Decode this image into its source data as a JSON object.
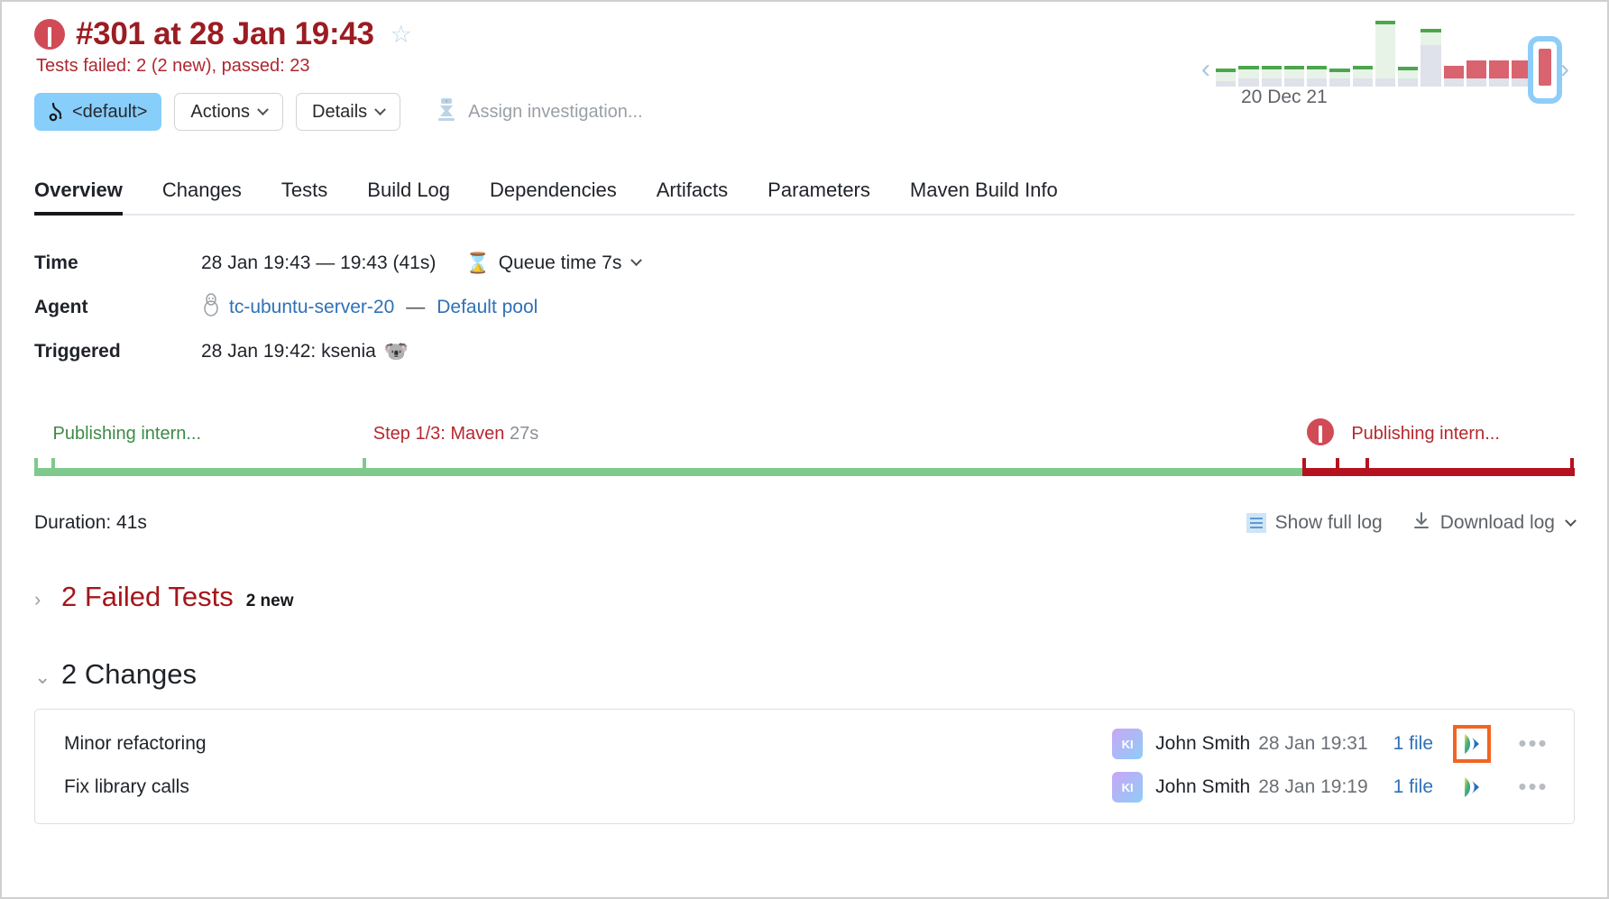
{
  "header": {
    "status_icon": "error-circle-icon",
    "title": "#301 at 28 Jan 19:43",
    "star_glyph": "☆",
    "status_text": "Tests failed: 2 (2 new), passed: 23"
  },
  "toolbar": {
    "branch_label": "<default>",
    "actions_label": "Actions",
    "details_label": "Details",
    "assign_label": "Assign investigation..."
  },
  "chart_data": {
    "type": "bar",
    "title": "",
    "xlabel": "",
    "ylabel": "",
    "prev_arrow": "‹",
    "next_arrow": "›",
    "date_label": "20 Dec 21",
    "categories": [
      "b1",
      "b2",
      "b3",
      "b4",
      "b5",
      "b6",
      "b7",
      "b8",
      "b9",
      "b10",
      "b11",
      "b12",
      "b13",
      "b14",
      "b15"
    ],
    "values": [
      14,
      14,
      14,
      14,
      14,
      11,
      14,
      64,
      13,
      18,
      14,
      20,
      20,
      20,
      46
    ],
    "statuses": [
      "ok",
      "ok",
      "ok",
      "ok",
      "ok",
      "ok",
      "ok",
      "ok",
      "ok",
      "ok",
      "fail",
      "fail",
      "fail",
      "fail",
      "fail"
    ],
    "under_values": [
      6,
      9,
      9,
      9,
      9,
      9,
      9,
      9,
      9,
      46,
      9,
      9,
      9,
      9,
      9
    ],
    "selected_index": 14
  },
  "tabs": [
    {
      "label": "Overview",
      "active": true
    },
    {
      "label": "Changes",
      "active": false
    },
    {
      "label": "Tests",
      "active": false
    },
    {
      "label": "Build Log",
      "active": false
    },
    {
      "label": "Dependencies",
      "active": false
    },
    {
      "label": "Artifacts",
      "active": false
    },
    {
      "label": "Parameters",
      "active": false
    },
    {
      "label": "Maven Build Info",
      "active": false
    }
  ],
  "info": {
    "time_label": "Time",
    "time_value": "28 Jan 19:43 — 19:43 (41s)",
    "queue_label": "Queue time 7s",
    "agent_label": "Agent",
    "agent_name": "tc-ubuntu-server-20",
    "agent_dash": "—",
    "agent_pool": "Default pool",
    "triggered_label": "Triggered",
    "triggered_value": "28 Jan 19:42: ksenia",
    "triggered_emoji": "🐨"
  },
  "timeline": {
    "labels": [
      {
        "text": "Publishing intern...",
        "dur": "",
        "color": "green",
        "left_pct": 1.2
      },
      {
        "text": "Step 1/3: Maven",
        "dur": "27s",
        "color": "red",
        "left_pct": 22.0
      },
      {
        "text": "Publishing intern...",
        "dur": "",
        "color": "red",
        "left_pct": 85.5
      }
    ],
    "green_end_pct": 82.3,
    "error_icon_pct": 82.6
  },
  "log": {
    "duration": "Duration: 41s",
    "show_full_log": "Show full log",
    "download_log": "Download log"
  },
  "failed_tests": {
    "chevron": "›",
    "title": "2 Failed Tests",
    "badge": "2 new"
  },
  "changes": {
    "chevron": "⌄",
    "title": "2 Changes",
    "rows": [
      {
        "description": "Minor refactoring",
        "avatar_initials": "KI",
        "author": "John Smith",
        "time": "28 Jan 19:31",
        "files": "1 file",
        "ide_icon": "intellij-idea-icon",
        "ide_selected": true,
        "more": "•••"
      },
      {
        "description": "Fix library calls",
        "avatar_initials": "KI",
        "author": "John Smith",
        "time": "28 Jan 19:19",
        "files": "1 file",
        "ide_icon": "intellij-idea-icon",
        "ide_selected": false,
        "more": "•••"
      }
    ]
  },
  "colors": {
    "error_red": "#a4161a",
    "status_red": "#af2730",
    "link_blue": "#2f71b8",
    "branch_blue": "#87cefa",
    "success_green": "#4ca64c",
    "fail_bar": "#d9636f",
    "ide_highlight": "#f26522"
  }
}
